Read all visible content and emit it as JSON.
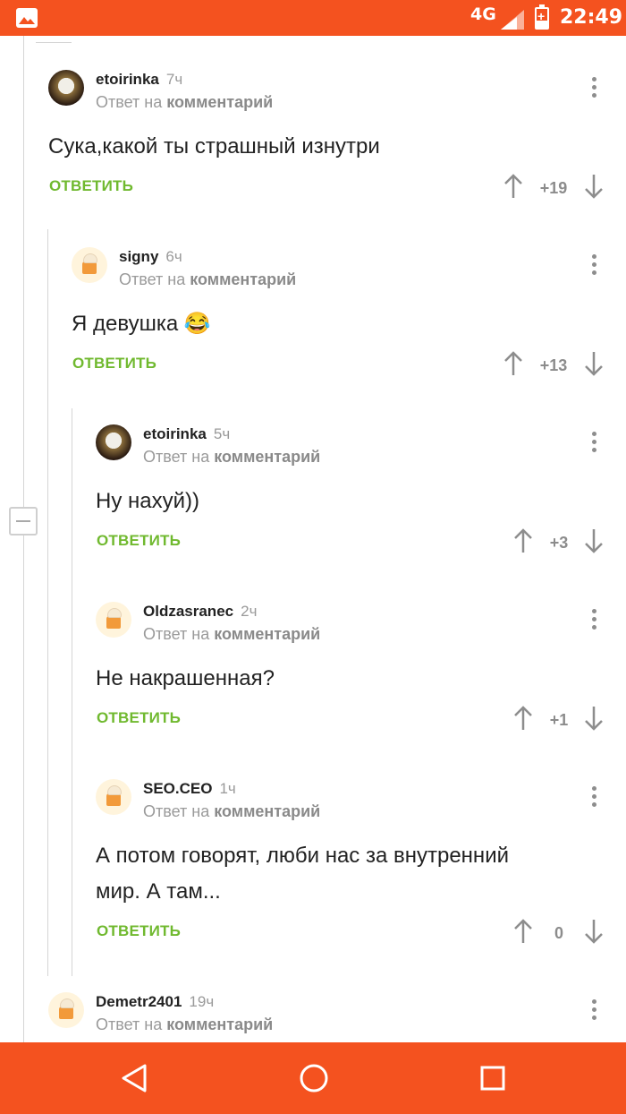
{
  "status_bar": {
    "network": "4G",
    "time": "22:49",
    "icons": [
      "image-icon",
      "signal-icon",
      "battery-charging-icon"
    ],
    "color": "#f4521f"
  },
  "comments": [
    {
      "username": "etoirinka",
      "time": "7ч",
      "reply_prefix": "Ответ на",
      "reply_target": "комментарий",
      "text": "Сука,какой ты страшный изнутри",
      "reply_label": "ОТВЕТИТЬ",
      "score": "+19",
      "avatar": "dark"
    },
    {
      "username": "signy",
      "time": "6ч",
      "reply_prefix": "Ответ на",
      "reply_target": "комментарий",
      "text": "Я девушка 😂",
      "reply_label": "ОТВЕТИТЬ",
      "score": "+13",
      "avatar": "light"
    },
    {
      "username": "etoirinka",
      "time": "5ч",
      "reply_prefix": "Ответ на",
      "reply_target": "комментарий",
      "text": "Ну нахуй))",
      "reply_label": "ОТВЕТИТЬ",
      "score": "+3",
      "avatar": "dark"
    },
    {
      "username": "Oldzasranec",
      "time": "2ч",
      "reply_prefix": "Ответ на",
      "reply_target": "комментарий",
      "text": "Не накрашенная?",
      "reply_label": "ОТВЕТИТЬ",
      "score": "+1",
      "avatar": "light"
    },
    {
      "username": "SEO.CEO",
      "time": "1ч",
      "reply_prefix": "Ответ на",
      "reply_target": "комментарий",
      "text_line1": "А потом говорят, люби нас за внутренний",
      "text_line2": "мир. А там...",
      "reply_label": "ОТВЕТИТЬ",
      "score": "0",
      "avatar": "light"
    },
    {
      "username": "Demetr2401",
      "time": "19ч",
      "reply_prefix": "Ответ на",
      "reply_target": "комментарий",
      "avatar": "light"
    }
  ],
  "colors": {
    "accent": "#f4521f",
    "reply_green": "#70b92f",
    "muted": "#9a9a9a"
  },
  "nav_bar": {
    "icons": [
      "back-triangle-icon",
      "home-circle-icon",
      "recents-square-icon"
    ]
  }
}
